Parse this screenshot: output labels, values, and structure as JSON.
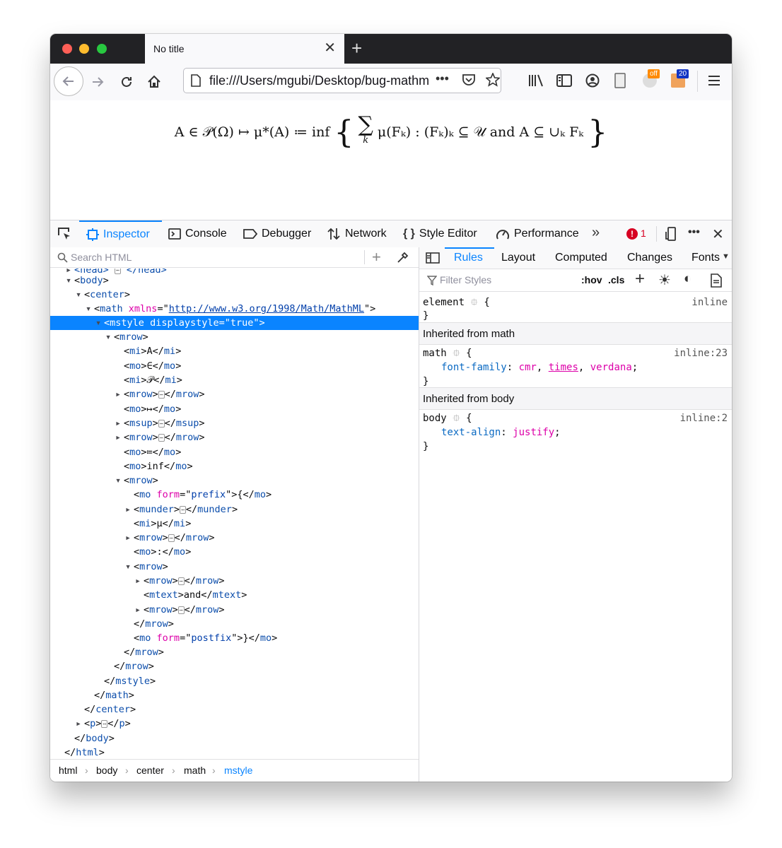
{
  "tab": {
    "title": "No title"
  },
  "nav": {
    "url": "file:///Users/mgubi/Desktop/bug-mathml",
    "badge_off": "off",
    "badge_count": "20"
  },
  "page": {
    "formula_left": "A ∈ 𝒫(Ω) ↦ μ*(A) ≔ inf",
    "formula_sum": "∑",
    "formula_sub": "k",
    "formula_right": "μ(Fₖ) : (Fₖ)ₖ ⊆ 𝒰 and A ⊆ ∪ₖ Fₖ"
  },
  "devtools": {
    "tabs": [
      "Inspector",
      "Console",
      "Debugger",
      "Network",
      "Style Editor",
      "Performance"
    ],
    "error_count": "1",
    "search_placeholder": "Search HTML",
    "breadcrumbs": [
      "html",
      "body",
      "center",
      "math",
      "mstyle"
    ],
    "rules_tabs": [
      "Rules",
      "Layout",
      "Computed",
      "Changes",
      "Fonts"
    ],
    "filter_placeholder": "Filter Styles",
    "hov": ":hov",
    "cls": ".cls",
    "element_rule": {
      "selector": "element",
      "source": "inline"
    },
    "inherited_math_header": "Inherited from math",
    "math_rule": {
      "selector": "math",
      "source": "inline:23",
      "property": "font-family",
      "value_1": "cmr",
      "value_2": "times",
      "value_3": "verdana"
    },
    "inherited_body_header": "Inherited from body",
    "body_rule": {
      "selector": "body",
      "source": "inline:2",
      "property": "text-align",
      "value": "justify"
    }
  }
}
